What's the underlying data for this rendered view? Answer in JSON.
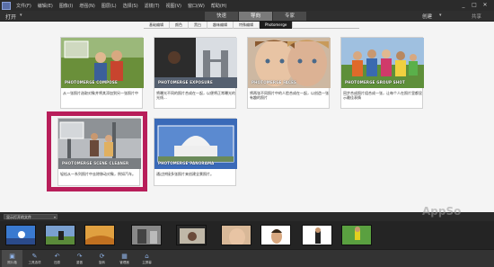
{
  "menu": {
    "items": [
      "文件(F)",
      "编辑(E)",
      "图像(I)",
      "增强(N)",
      "图层(L)",
      "选择(S)",
      "滤镜(T)",
      "视图(V)",
      "窗口(W)",
      "帮助(H)"
    ]
  },
  "window_controls": {
    "minimize": "_",
    "maximize": "□",
    "close": "✕"
  },
  "toolbar": {
    "open_label": "打开",
    "open_caret": "▾",
    "modes": [
      {
        "label": "快速",
        "active": false
      },
      {
        "label": "导向",
        "active": true
      },
      {
        "label": "专家",
        "active": false
      }
    ],
    "create_label": "创建",
    "create_caret": "▾",
    "share_label": "共享"
  },
  "categories": [
    {
      "label": "基础编辑",
      "active": false
    },
    {
      "label": "颜色",
      "active": false
    },
    {
      "label": "黑白",
      "active": false
    },
    {
      "label": "趣味编辑",
      "active": false
    },
    {
      "label": "特殊编辑",
      "active": false
    },
    {
      "label": "Photomerge",
      "active": true
    }
  ],
  "cards": [
    {
      "title": "PHOTOMERGE COMPOSE",
      "desc": "从一张照片选取对象并将其添加到另一张照片中"
    },
    {
      "title": "PHOTOMERGE EXPOSURE",
      "desc": "将曝光不同的照片合成在一起，以便将正常曝光的光线..."
    },
    {
      "title": "PHOTOMERGE FACES",
      "desc": "将两张不同照片中的人脸合成在一起，以创造一张有趣的照片"
    },
    {
      "title": "PHOTOMERGE GROUP SHOT",
      "desc": "同步合成照片组合成一张，让每个人在照片里都显示最佳表情"
    },
    {
      "title": "PHOTOMERGE SCENE CLEANER",
      "desc": "轻松从一系列照片中去除移动对象，例如汽车。"
    },
    {
      "title": "PHOTOMERGE PANORAMA",
      "desc": "通过拼接多张照片来创建全景照片。"
    }
  ],
  "bin": {
    "label": "显示打开的文件",
    "caret": "▾"
  },
  "bottom_bar": [
    {
      "label": "照片箱",
      "icon": "photo-bin-icon",
      "glyph": "▣",
      "active": true
    },
    {
      "label": "工具选项",
      "icon": "tool-options-icon",
      "glyph": "✎",
      "active": false
    },
    {
      "label": "还原",
      "icon": "undo-icon",
      "glyph": "↶",
      "active": false
    },
    {
      "label": "重做",
      "icon": "redo-icon",
      "glyph": "↷",
      "active": false
    },
    {
      "label": "旋转",
      "icon": "rotate-icon",
      "glyph": "⟳",
      "active": false
    },
    {
      "label": "管理器",
      "icon": "organizer-icon",
      "glyph": "▦",
      "active": false
    },
    {
      "label": "主屏幕",
      "icon": "home-icon",
      "glyph": "⌂",
      "active": false
    }
  ],
  "watermark": "AppSo",
  "colors": {
    "highlight": "#b81e5a",
    "active_tab": "#7a7a7a",
    "workspace": "#f4f4f4"
  }
}
